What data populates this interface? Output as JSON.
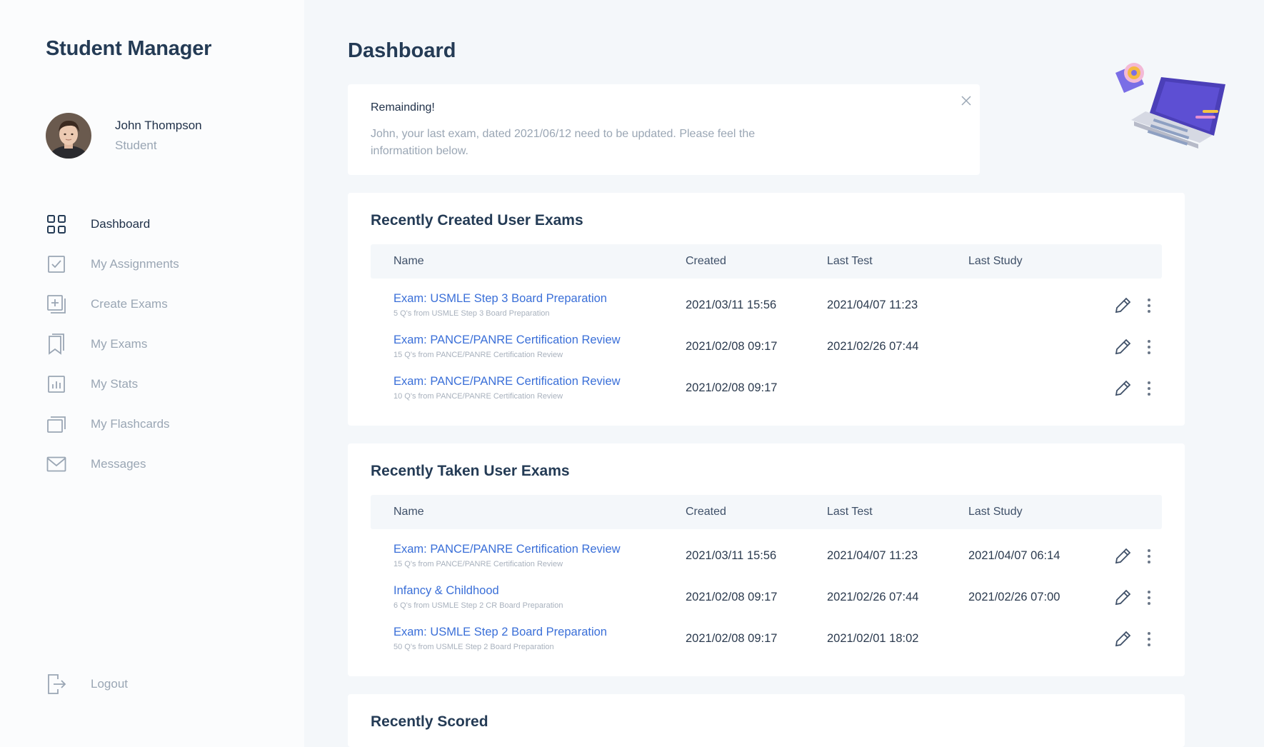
{
  "app": {
    "title": "Student Manager"
  },
  "user": {
    "name": "John Thompson",
    "role": "Student"
  },
  "nav": {
    "items": [
      {
        "label": "Dashboard",
        "icon": "grid-icon",
        "active": true
      },
      {
        "label": "My Assignments",
        "icon": "checkbox-icon"
      },
      {
        "label": "Create Exams",
        "icon": "add-document-icon"
      },
      {
        "label": "My Exams",
        "icon": "bookmark-icon"
      },
      {
        "label": "My Stats",
        "icon": "bar-chart-icon"
      },
      {
        "label": "My Flashcards",
        "icon": "cards-icon"
      },
      {
        "label": "Messages",
        "icon": "mail-icon"
      }
    ],
    "logout": "Logout"
  },
  "page": {
    "title": "Dashboard"
  },
  "alert": {
    "title": "Remainding!",
    "text": "John, your last exam, dated 2021/06/12 need to be updated. Please feel the informatition below."
  },
  "table_headers": {
    "name": "Name",
    "created": "Created",
    "last_test": "Last Test",
    "last_study": "Last Study"
  },
  "recent_created": {
    "title": "Recently Created User Exams",
    "rows": [
      {
        "name": "Exam: USMLE Step 3 Board Preparation",
        "sub": "5 Q's from USMLE Step 3 Board Preparation",
        "created": "2021/03/11 15:56",
        "last_test": "2021/04/07 11:23",
        "last_study": ""
      },
      {
        "name": "Exam: PANCE/PANRE Certification Review",
        "sub": "15 Q's from PANCE/PANRE Certification Review",
        "created": "2021/02/08 09:17",
        "last_test": "2021/02/26 07:44",
        "last_study": ""
      },
      {
        "name": "Exam: PANCE/PANRE Certification Review",
        "sub": "10 Q's from PANCE/PANRE Certification Review",
        "created": "2021/02/08 09:17",
        "last_test": "",
        "last_study": ""
      }
    ]
  },
  "recent_taken": {
    "title": "Recently Taken User Exams",
    "rows": [
      {
        "name": "Exam: PANCE/PANRE Certification Review",
        "sub": "15 Q's from PANCE/PANRE Certification Review",
        "created": "2021/03/11 15:56",
        "last_test": "2021/04/07 11:23",
        "last_study": "2021/04/07 06:14"
      },
      {
        "name": "Infancy & Childhood",
        "sub": "6 Q's from USMLE Step 2 CR Board Preparation",
        "created": "2021/02/08 09:17",
        "last_test": "2021/02/26 07:44",
        "last_study": "2021/02/26 07:00"
      },
      {
        "name": "Exam: USMLE Step 2 Board Preparation",
        "sub": "50 Q's from USMLE Step 2 Board Preparation",
        "created": "2021/02/08 09:17",
        "last_test": "2021/02/01 18:02",
        "last_study": ""
      }
    ]
  },
  "recent_scored": {
    "title": "Recently Scored"
  },
  "colors": {
    "link": "#3a6fd8",
    "heading": "#243b55",
    "muted": "#9aa6b4",
    "background": "#f4f7fa",
    "card": "#ffffff"
  }
}
